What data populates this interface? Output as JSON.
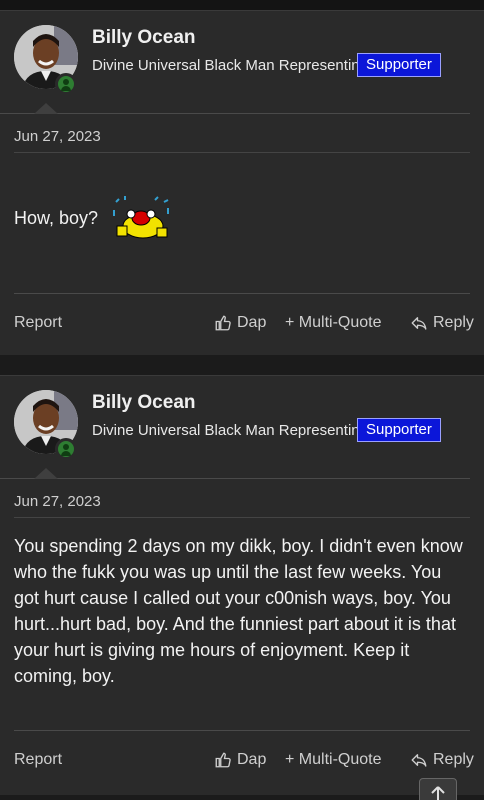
{
  "posts": [
    {
      "username": "Billy Ocean",
      "user_title": "Divine Universal Black Man Representin'",
      "badge": "Supporter",
      "date": "Jun 27, 2023",
      "body": "How, boy?",
      "emoji": "crying-laughing-emoji",
      "actions": {
        "report": "Report",
        "dap": "Dap",
        "multi_quote": "+ Multi-Quote",
        "reply": "Reply"
      }
    },
    {
      "username": "Billy Ocean",
      "user_title": "Divine Universal Black Man Representin'",
      "badge": "Supporter",
      "date": "Jun 27, 2023",
      "body": "You spending 2 days on my dikk, boy. I didn't even know who the fukk you was up until the last few weeks. You got hurt cause I called out your c00nish ways, boy. You hurt...hurt bad, boy. And the funniest part about it is that your hurt is giving me hours of enjoyment. Keep it coming, boy.",
      "actions": {
        "report": "Report",
        "dap": "Dap",
        "multi_quote": "+ Multi-Quote",
        "reply": "Reply"
      }
    }
  ],
  "colors": {
    "badge_bg": "#0b16d9",
    "online": "#2e7d32",
    "page_bg": "#1b1b1b",
    "post_bg": "#2a2a2a"
  },
  "icons": [
    "thumbs-up-icon",
    "reply-icon",
    "arrow-up-icon",
    "online-user-icon"
  ]
}
